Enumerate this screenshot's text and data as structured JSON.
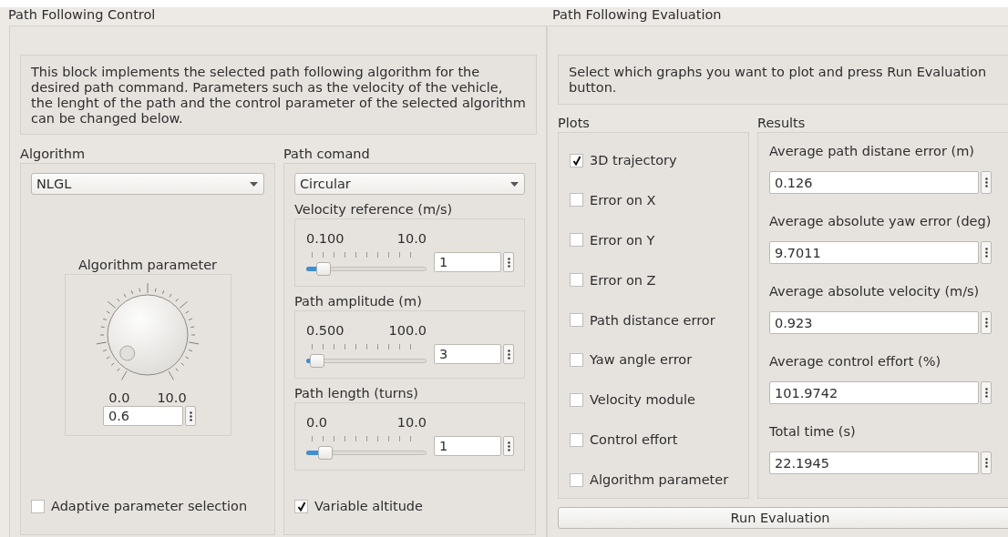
{
  "control": {
    "title": "Path Following Control",
    "description": "This block implements the selected path following algorithm for the desired path command. Parameters such as the velocity of the vehicle, the lenght of the path and the control parameter of the selected algorithm can be changed below.",
    "algorithm": {
      "label": "Algorithm",
      "selection": "NLGL",
      "parameter": {
        "label": "Algorithm parameter",
        "min": "0.0",
        "max": "10.0",
        "value": "0.6"
      },
      "adaptive": {
        "label": "Adaptive parameter selection",
        "checked": false
      }
    },
    "path": {
      "label": "Path comand",
      "selection": "Circular",
      "sliders": [
        {
          "label": "Velocity reference (m/s)",
          "min": "0.100",
          "max": "10.0",
          "level": 0.09,
          "value": "1"
        },
        {
          "label": "Path amplitude (m)",
          "min": "0.500",
          "max": "100.0",
          "level": 0.03,
          "value": "3"
        },
        {
          "label": "Path length (turns)",
          "min": "0.0",
          "max": "10.0",
          "level": 0.1,
          "value": "1"
        }
      ],
      "variable_altitude": {
        "label": "Variable altitude",
        "checked": true
      }
    }
  },
  "evaluation": {
    "title": "Path Following Evaluation",
    "description": "Select which graphs you want to plot and press Run Evaluation button.",
    "plots": {
      "label": "Plots",
      "items": [
        {
          "label": "3D trajectory",
          "checked": true
        },
        {
          "label": "Error on X",
          "checked": false
        },
        {
          "label": "Error on Y",
          "checked": false
        },
        {
          "label": "Error on Z",
          "checked": false
        },
        {
          "label": "Path distance error",
          "checked": false
        },
        {
          "label": "Yaw angle error",
          "checked": false
        },
        {
          "label": "Velocity module",
          "checked": false
        },
        {
          "label": "Control effort",
          "checked": false
        },
        {
          "label": "Algorithm parameter",
          "checked": false
        }
      ]
    },
    "results": {
      "label": "Results",
      "items": [
        {
          "label": "Average path distane error (m)",
          "value": "0.126"
        },
        {
          "label": "Average absolute yaw error (deg)",
          "value": "9.7011"
        },
        {
          "label": "Average absolute velocity (m/s)",
          "value": "0.923"
        },
        {
          "label": "Average control effort (%)",
          "value": "101.9742"
        },
        {
          "label": "Total time (s)",
          "value": "22.1945"
        }
      ]
    },
    "run_button": "Run Evaluation"
  }
}
